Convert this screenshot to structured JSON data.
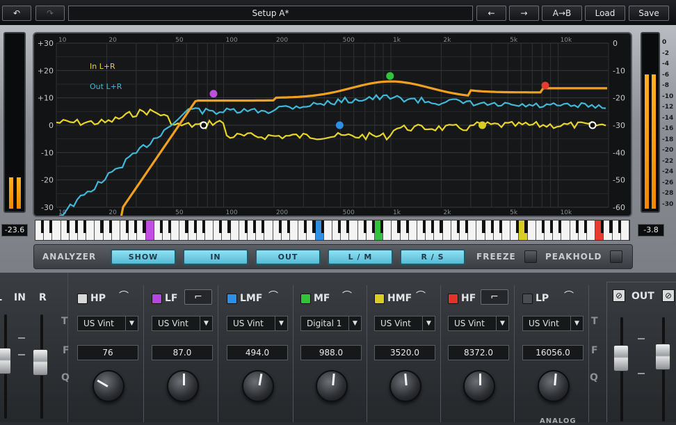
{
  "topbar": {
    "undo_label": "↶",
    "redo_label": "↷",
    "setup_name": "Setup A*",
    "prev_label": "←",
    "next_label": "→",
    "ab_label": "A→B",
    "load_label": "Load",
    "save_label": "Save"
  },
  "meters": {
    "in_readout": "-23.6",
    "in_levels": [
      0.18,
      0.18
    ],
    "out_readout": "-3.8",
    "out_levels": [
      0.78,
      0.78
    ],
    "out_scale": [
      "0",
      "-2",
      "-4",
      "-6",
      "-8",
      "-10",
      "-12",
      "-14",
      "-16",
      "-18",
      "-20",
      "-22",
      "-24",
      "-26",
      "-28",
      "-30"
    ]
  },
  "graph": {
    "x_ticks_top": [
      "10",
      "20",
      "50",
      "100",
      "200",
      "500",
      "1k",
      "2k",
      "5k",
      "10k"
    ],
    "x_ticks_bottom": [
      "10",
      "20",
      "50",
      "100",
      "200",
      "500",
      "1k",
      "2k",
      "5k",
      "10k"
    ],
    "y_left": [
      "+30",
      "+20",
      "+10",
      "0",
      "-10",
      "-20",
      "-30"
    ],
    "y_right": [
      "0",
      "-10",
      "-20",
      "-30",
      "-40",
      "-50",
      "-60"
    ],
    "legend_in": "In L+R",
    "legend_out": "Out L+R",
    "colors": {
      "eq_curve": "#f0a020",
      "in": "#e6d42a",
      "out": "#41b8d8",
      "hp": "#ffffff",
      "lf": "#c04ee0",
      "lmf": "#2d8fe6",
      "mf": "#33c23e",
      "hmf": "#d8cc25",
      "hf": "#e83a2e"
    }
  },
  "analyzer": {
    "label": "ANALYZER",
    "buttons": [
      "SHOW",
      "IN",
      "OUT",
      "L / M",
      "R / S"
    ],
    "freeze_label": "FREEZE",
    "peakhold_label": "PEAKHOLD"
  },
  "input": {
    "label_l": "L",
    "label_in": "IN",
    "label_r": "R"
  },
  "output": {
    "label": "OUT"
  },
  "row_labels": {
    "t": "T",
    "f": "F",
    "q": "Q"
  },
  "bands": [
    {
      "name": "HP",
      "led": "#d8d8d8",
      "shape": "⌒",
      "type": "US Vint",
      "freq": "76",
      "knob": -60
    },
    {
      "name": "LF",
      "led": "#b447de",
      "shape": "⌐",
      "type": "US Vint",
      "freq": "87.0",
      "knob": 0
    },
    {
      "name": "LMF",
      "led": "#2d8fe6",
      "shape": "⌒",
      "type": "US Vint",
      "freq": "494.0",
      "knob": 10
    },
    {
      "name": "MF",
      "led": "#33c23e",
      "shape": "⌒",
      "type": "Digital 1",
      "freq": "988.0",
      "knob": 5
    },
    {
      "name": "HMF",
      "led": "#d8cc25",
      "shape": "⌒",
      "type": "US Vint",
      "freq": "3520.0",
      "knob": -5
    },
    {
      "name": "HF",
      "led": "#e0332a",
      "shape": "⌐",
      "type": "US Vint",
      "freq": "8372.0",
      "knob": 0
    },
    {
      "name": "LP",
      "led": "#4a4d51",
      "shape": "⌒",
      "type": "US Vint",
      "freq": "16056.0",
      "knob": 5
    }
  ],
  "footer_text": "ANALOG"
}
